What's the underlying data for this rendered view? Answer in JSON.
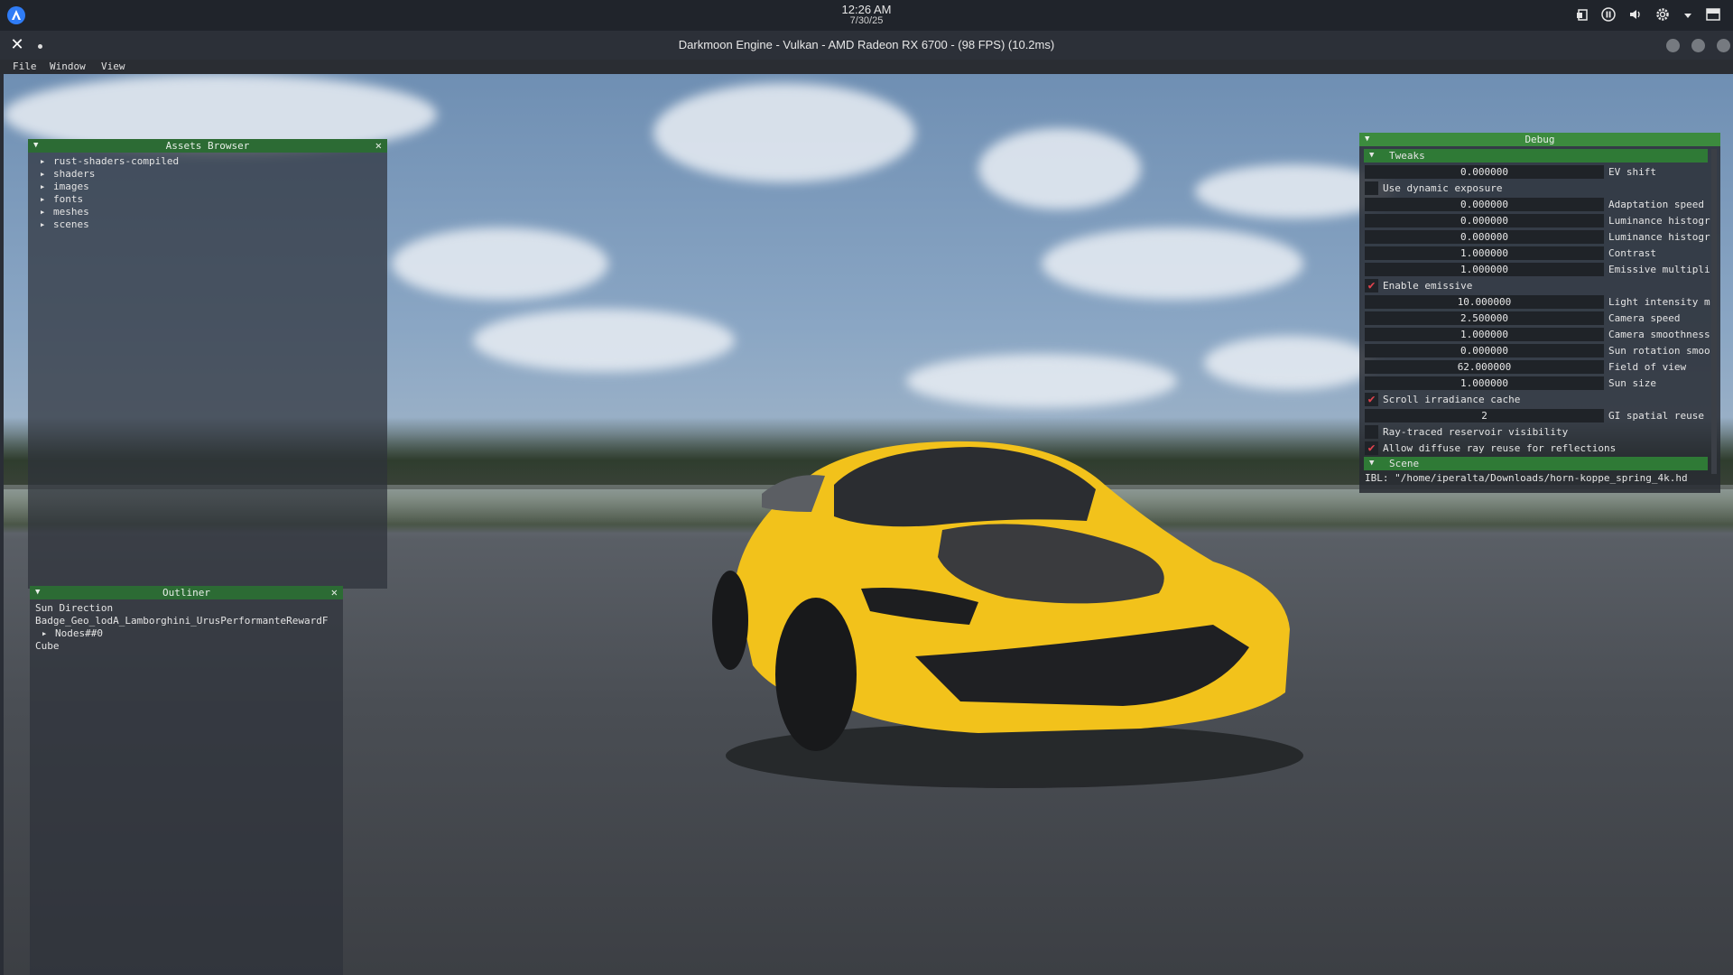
{
  "os_panel": {
    "time": "12:26 AM",
    "date": "7/30/25"
  },
  "window": {
    "title": "Darkmoon Engine - Vulkan - AMD Radeon RX 6700 - (98 FPS) (10.2ms)",
    "close_symbol": "✕"
  },
  "menu": {
    "file": "File",
    "window": "Window",
    "view": "View"
  },
  "assets_browser": {
    "title": "Assets Browser",
    "items": [
      "rust-shaders-compiled",
      "shaders",
      "images",
      "fonts",
      "meshes",
      "scenes"
    ]
  },
  "outliner": {
    "title": "Outliner",
    "sun_direction": "Sun Direction",
    "badge": "Badge_Geo_lodA_Lamborghini_UrusPerformanteRewardF",
    "nodes": "Nodes##0",
    "cube": "Cube"
  },
  "debug": {
    "title": "Debug",
    "tweaks_label": "Tweaks",
    "scene_label": "Scene",
    "ev_shift": {
      "value": "0.000000",
      "label": "EV shift"
    },
    "use_dynamic_exposure": {
      "label": "Use dynamic exposure",
      "checked": false
    },
    "adaptation_speed": {
      "value": "0.000000",
      "label": "Adaptation speed"
    },
    "luminance_histogram_1": {
      "value": "0.000000",
      "label": "Luminance histogr"
    },
    "luminance_histogram_2": {
      "value": "0.000000",
      "label": "Luminance histogr"
    },
    "contrast": {
      "value": "1.000000",
      "label": "Contrast"
    },
    "emissive_multiplier": {
      "value": "1.000000",
      "label": "Emissive multipli"
    },
    "enable_emissive": {
      "label": "Enable emissive",
      "checked": true
    },
    "light_intensity": {
      "value": "10.000000",
      "label": "Light intensity m"
    },
    "camera_speed": {
      "value": "2.500000",
      "label": "Camera speed"
    },
    "camera_smoothness": {
      "value": "1.000000",
      "label": "Camera smoothness"
    },
    "sun_rotation_smoothness": {
      "value": "0.000000",
      "label": "Sun rotation smoo"
    },
    "field_of_view": {
      "value": "62.000000",
      "label": "Field of view"
    },
    "sun_size": {
      "value": "1.000000",
      "label": "Sun size"
    },
    "scroll_irradiance_cache": {
      "label": "Scroll irradiance cache",
      "checked": true
    },
    "gi_spatial_reuse": {
      "value": "2",
      "label": "GI spatial reuse"
    },
    "ray_traced_reservoir_visibility": {
      "label": "Ray-traced reservoir visibility",
      "checked": false
    },
    "allow_diffuse_ray_reuse": {
      "label": "Allow diffuse ray reuse for reflections",
      "checked": true
    },
    "ibl": "IBL: \"/home/iperalta/Downloads/horn-koppe_spring_4k.hd"
  },
  "colors": {
    "panel_header": "#2c6b34",
    "debug_header": "#3c8b3e",
    "checkmark": "#e0434d",
    "car_body": "#f2c21b"
  }
}
